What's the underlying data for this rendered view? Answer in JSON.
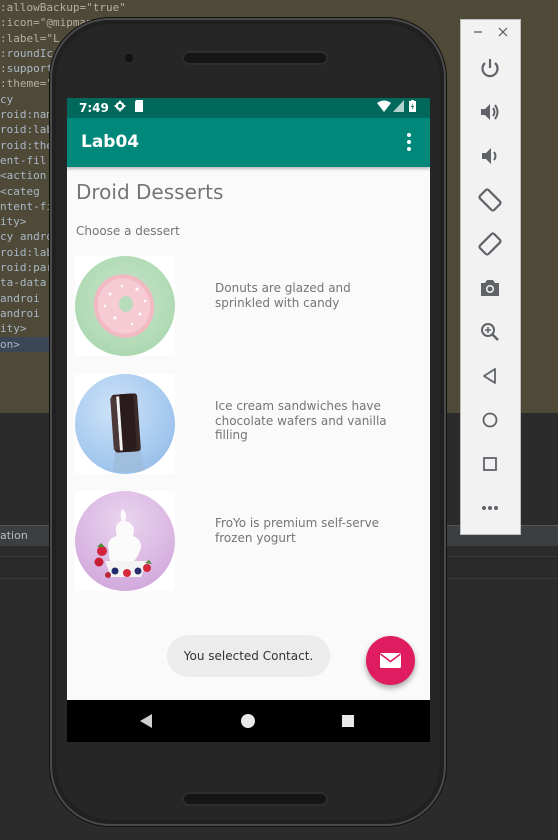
{
  "ide": {
    "code_lines": [
      ":allowBackup=\"true\"",
      ":icon=\"@mipmap",
      ":label=\"L",
      ":roundIc",
      ":support",
      ":theme=\"",
      "cy",
      "roid:nam",
      "roid:lab",
      "roid:the",
      "ent-fil",
      "<action",
      "",
      "<categ",
      "ntent-fi",
      "ity>",
      "cy andro",
      "roid:lab",
      "roid:par",
      "ta-data",
      "androi",
      "androi",
      "ity>",
      "on>"
    ],
    "bottom_tab_label": "ation"
  },
  "status_bar": {
    "time": "7:49"
  },
  "app_bar": {
    "title": "Lab04"
  },
  "main": {
    "heading": "Droid Desserts",
    "subheading": "Choose a dessert",
    "items": [
      {
        "image": "donut-image",
        "description": "Donuts are glazed and sprinkled with candy"
      },
      {
        "image": "ice-cream-sandwich-image",
        "description": "Ice cream sandwiches have chocolate wafers and vanilla filling"
      },
      {
        "image": "froyo-image",
        "description": "FroYo is premium self-serve frozen yogurt"
      }
    ]
  },
  "toast": {
    "text": "You selected Contact."
  },
  "fab": {
    "icon": "mail-icon",
    "color": "#e01c60"
  },
  "colors": {
    "primary": "#00897b",
    "primary_dark": "#00695c",
    "accent": "#e01c60"
  },
  "emulator_toolbar": {
    "buttons": [
      "minimize-icon",
      "close-icon",
      "power-icon",
      "volume-up-icon",
      "volume-down-icon",
      "rotate-left-icon",
      "rotate-right-icon",
      "camera-icon",
      "zoom-icon",
      "back-icon",
      "home-icon",
      "overview-icon",
      "more-icon"
    ]
  }
}
